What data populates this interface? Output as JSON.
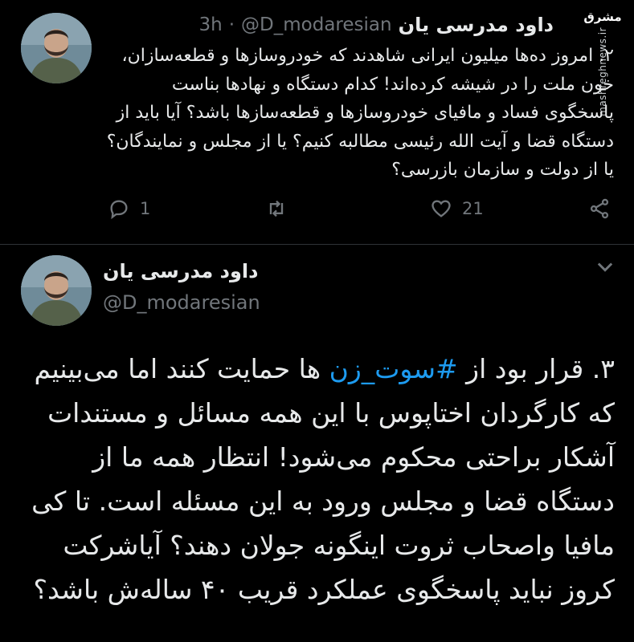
{
  "tweet1": {
    "author_name": "داود مدرسی یان",
    "handle": "@D_modaresian",
    "separator": "·",
    "time": "3h",
    "body": "۲. امروز ده‌ها میلیون ایرانی شاهدند که خودروسازها و قطعه‌سازان، خون ملت را در شیشه کرده‌اند! کدام دستگاه و نهادها بناست پاسخگوی فساد و مافیای خودروسازها و قطعه‌سازها باشد؟ آیا باید از دستگاه قضا و آیت الله رئیسی مطالبه کنیم؟ یا از مجلس و نمایندگان؟ یا از دولت و سازمان بازرسی؟",
    "actions": {
      "reply_count": "1",
      "retweet_count": "",
      "like_count": "21"
    },
    "icons": [
      "reply-icon",
      "retweet-icon",
      "like-icon",
      "share-icon"
    ]
  },
  "watermark": {
    "logo": "مشرق",
    "url": "mashreghnews.ir"
  },
  "tweet2": {
    "author_name": "داود مدرسی یان",
    "handle": "@D_modaresian",
    "body_prefix": "۳. قرار بود از ",
    "hashtag": "#سوت_زن",
    "body_rest": " ها حمایت کنند اما می‌بینیم که کارگردان اختاپوس با این همه مسائل و مستندات آشکار براحتی محکوم می‌شود! انتظار همه ما از دستگاه قضا و مجلس ورود به این مسئله است. تا کی مافیا واصحاب ثروت اینگونه جولان دهند؟ آیاشرکت کروز نباید پاسخگوی عملکرد قریب ۴۰ ساله‌ش باشد؟",
    "icons": [
      "chevron-down-icon"
    ]
  },
  "colors": {
    "background": "#000000",
    "text": "#e7e9ea",
    "muted": "#71767b",
    "link": "#1d9bf0"
  }
}
